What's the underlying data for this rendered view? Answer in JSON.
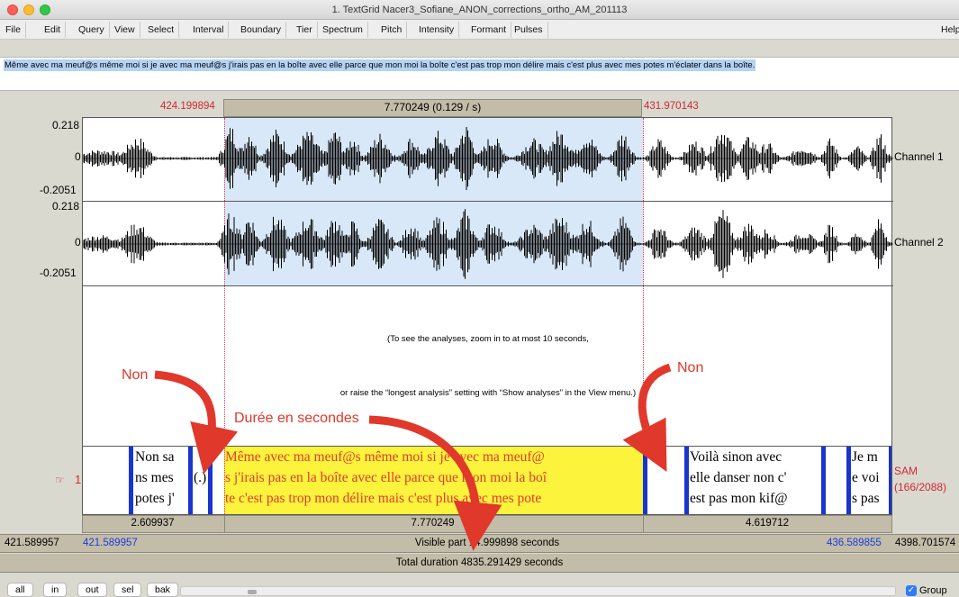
{
  "window": {
    "title": "1. TextGrid Nacer3_Sofiane_ANON_corrections_ortho_AM_201113"
  },
  "menu": [
    "File",
    "Edit",
    "Query",
    "View",
    "Select",
    "Interval",
    "Boundary",
    "Tier",
    "Spectrum",
    "Pitch",
    "Intensity",
    "Formant",
    "Pulses",
    "Help"
  ],
  "text_field": {
    "value": "Même avec ma meuf@s même moi si je avec ma meuf@s j'irais pas en la boîte avec elle parce que mon moi la boîte c'est pas trop mon délire mais c'est plus avec mes potes m'éclater dans la boîte."
  },
  "selection": {
    "start": "424.199894",
    "duration_label": "7.770249 (0.129 / s)",
    "end": "431.970143"
  },
  "channels": [
    {
      "name": "Channel 1",
      "max": "0.218",
      "zero": "0",
      "min": "-0.2051"
    },
    {
      "name": "Channel 2",
      "max": "0.218",
      "zero": "0",
      "min": "-0.2051"
    }
  ],
  "analysis_message": {
    "line1": "(To see the analyses, zoom in to at most 10 seconds,",
    "line2": "or raise the “longest analysis” setting with “Show analyses” in the View menu.)"
  },
  "annotations": {
    "non_left": "Non",
    "non_right": "Non",
    "duree": "Durée en secondes"
  },
  "tier": {
    "number": "1",
    "pointer_glyph": "☞",
    "name": "SAM",
    "count": "(166/2088)",
    "cells": [
      {
        "text": "Non sa\nns mes\npotes j'"
      },
      {
        "text": "(.)"
      },
      {
        "text": "Même avec ma meuf@s même moi si je avec ma meuf@\ns j'irais pas en la boîte avec elle parce que mon moi la boî\nte c'est pas trop mon délire mais c'est plus avec mes pote"
      },
      {
        "text": ""
      },
      {
        "text": "Voilà sinon avec\nelle danser non c'\nest pas mon kif@"
      },
      {
        "text": ""
      },
      {
        "text": "Je m\ne voi\ns pas"
      }
    ]
  },
  "durations": {
    "left": "2.609937",
    "middle": "7.770249",
    "right": "4.619712"
  },
  "visible": {
    "outer_start": "421.589957",
    "start": "421.589957",
    "label": "Visible part 14.999898 seconds",
    "end": "436.589855",
    "outer_end": "4398.701574"
  },
  "total": {
    "label": "Total duration 4835.291429 seconds"
  },
  "buttons": [
    "all",
    "in",
    "out",
    "sel",
    "bak"
  ],
  "group": {
    "label": "Group",
    "checked": true
  },
  "colors": {
    "selection": "#d8e8f8",
    "highlight": "#fbf33c",
    "boundary": "#1a35cf",
    "accent_red": "#d2282e",
    "arrow": "#e0382b"
  }
}
